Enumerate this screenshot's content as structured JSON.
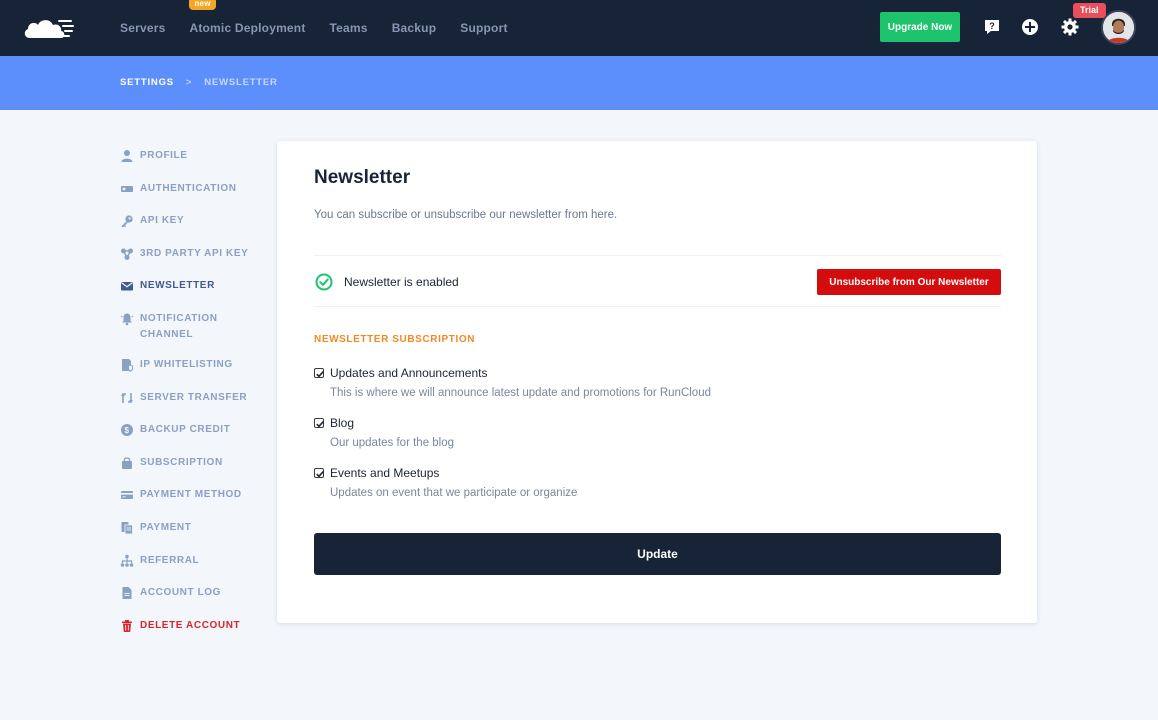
{
  "nav": {
    "items": [
      {
        "label": "Servers"
      },
      {
        "label": "Atomic Deployment",
        "badge": "new"
      },
      {
        "label": "Teams"
      },
      {
        "label": "Backup"
      },
      {
        "label": "Support"
      }
    ],
    "upgrade_label": "Upgrade Now",
    "trial_badge": "Trial",
    "icons": [
      "help-icon",
      "add-icon",
      "settings-icon"
    ],
    "accent_color": "#1dc46d"
  },
  "breadcrumb": {
    "items": [
      "SETTINGS",
      "NEWSLETTER"
    ],
    "separator": ">"
  },
  "sidebar": {
    "items": [
      {
        "label": "PROFILE",
        "icon": "user-icon"
      },
      {
        "label": "AUTHENTICATION",
        "icon": "key-card-icon"
      },
      {
        "label": "API KEY",
        "icon": "key-icon"
      },
      {
        "label": "3RD PARTY API KEY",
        "icon": "connections-icon"
      },
      {
        "label": "NEWSLETTER",
        "icon": "envelope-icon",
        "active": true
      },
      {
        "label": "NOTIFICATION CHANNEL",
        "icon": "bell-icon"
      },
      {
        "label": "IP WHITELISTING",
        "icon": "shield-doc-icon"
      },
      {
        "label": "SERVER TRANSFER",
        "icon": "transfer-icon"
      },
      {
        "label": "BACKUP CREDIT",
        "icon": "dollar-icon"
      },
      {
        "label": "SUBSCRIPTION",
        "icon": "bag-icon"
      },
      {
        "label": "PAYMENT METHOD",
        "icon": "credit-card-icon"
      },
      {
        "label": "PAYMENT",
        "icon": "receipt-icon"
      },
      {
        "label": "REFERRAL",
        "icon": "network-icon"
      },
      {
        "label": "ACCOUNT LOG",
        "icon": "document-icon"
      },
      {
        "label": "DELETE ACCOUNT",
        "icon": "trash-icon",
        "danger": true
      }
    ]
  },
  "main": {
    "title": "Newsletter",
    "description": "You can subscribe or unsubscribe our newsletter from here.",
    "status_text": "Newsletter is enabled",
    "unsubscribe_label": "Unsubscribe from Our Newsletter",
    "section_title": "NEWSLETTER SUBSCRIPTION",
    "options": [
      {
        "label": "Updates and Announcements",
        "description": "This is where we will announce latest update and promotions for RunCloud",
        "checked": true
      },
      {
        "label": "Blog",
        "description": "Our updates for the blog",
        "checked": true
      },
      {
        "label": "Events and Meetups",
        "description": "Updates on event that we participate or organize",
        "checked": true
      }
    ],
    "update_label": "Update"
  },
  "colors": {
    "topbar": "#172337",
    "breadcrumb_bar": "#5d8ffc",
    "danger": "#d30d0d",
    "section_title": "#f08a24",
    "success": "#1dc46d"
  }
}
